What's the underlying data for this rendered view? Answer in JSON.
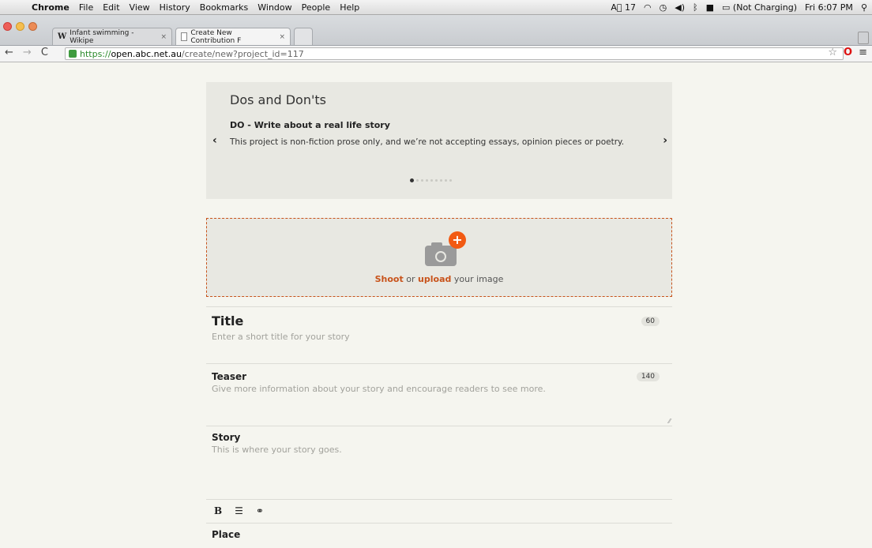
{
  "menubar": {
    "apple": "",
    "items": [
      "Chrome",
      "File",
      "Edit",
      "View",
      "History",
      "Bookmarks",
      "Window",
      "People",
      "Help"
    ],
    "tray": {
      "adobe": "17",
      "battery": "(Not Charging)",
      "clock": "Fri 6:07 PM"
    }
  },
  "tabs": [
    {
      "title": "Infant swimming - Wikipe",
      "favicon": "W"
    },
    {
      "title": "Create New Contribution F"
    }
  ],
  "url": {
    "scheme": "https://",
    "host": "open.abc.net.au",
    "path": "/create/new?project_id=117"
  },
  "dos": {
    "heading": "Dos and Don'ts",
    "item_title": "DO - Write about a real life story",
    "item_text": "This project is non-fiction prose only, and we’re not accepting essays, opinion pieces or poetry.",
    "prev": "‹",
    "next": "›",
    "dots_total": 9,
    "dots_active": 1
  },
  "upload": {
    "shoot": "Shoot",
    "or": "or",
    "upload": "upload",
    "rest": "your image"
  },
  "title_field": {
    "label": "Title",
    "placeholder": "Enter a short title for your story",
    "limit": "60"
  },
  "teaser_field": {
    "label": "Teaser",
    "placeholder": "Give more information about your story and encourage readers to see more.",
    "limit": "140"
  },
  "story_field": {
    "label": "Story",
    "placeholder": "This is where your story goes."
  },
  "toolbar": {
    "bold": "B"
  },
  "place_field": {
    "label": "Place"
  }
}
